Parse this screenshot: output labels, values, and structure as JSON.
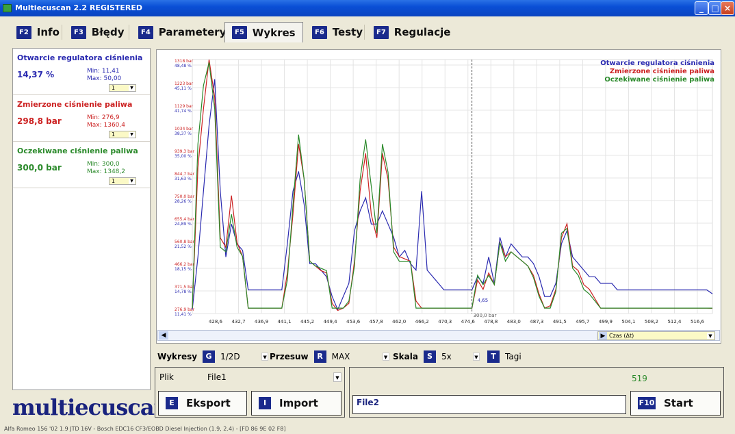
{
  "window": {
    "title": "Multiecuscan 2.2 REGISTERED"
  },
  "tabs": [
    {
      "key": "F2",
      "label": "Info"
    },
    {
      "key": "F3",
      "label": "Błędy"
    },
    {
      "key": "F4",
      "label": "Parametery"
    },
    {
      "key": "F5",
      "label": "Wykres",
      "active": true
    },
    {
      "key": "F6",
      "label": "Testy"
    },
    {
      "key": "F7",
      "label": "Regulacje"
    }
  ],
  "params": [
    {
      "name": "Otwarcie regulatora ciśnienia",
      "value": "14,37 %",
      "min": "Min: 11,41",
      "max": "Max: 50,00",
      "scale": "1",
      "color": "#2a2ab0"
    },
    {
      "name": "Zmierzone ciśnienie paliwa",
      "value": "298,8 bar",
      "min": "Min: 276,9",
      "max": "Max: 1360,4",
      "scale": "1",
      "color": "#cc2222"
    },
    {
      "name": "Oczekiwane ciśnienie paliwa",
      "value": "300,0 bar",
      "min": "Min: 300,0",
      "max": "Max: 1348,2",
      "scale": "1",
      "color": "#2b8a2b"
    }
  ],
  "logo": "multiecuscan",
  "chart_data": {
    "type": "line",
    "x": [
      426,
      427,
      428,
      429,
      430,
      431,
      432,
      433,
      434,
      435,
      436,
      437,
      438,
      439,
      440,
      441,
      442,
      443,
      444,
      445,
      446,
      447,
      448,
      449,
      450,
      451,
      452,
      453,
      454,
      455,
      456,
      457,
      458,
      459,
      460,
      461,
      462,
      463,
      464,
      465,
      466,
      467,
      468,
      469,
      470,
      471,
      472,
      473,
      474,
      475,
      476,
      477,
      478,
      479,
      480,
      481,
      482,
      483,
      484,
      485,
      486,
      487,
      488,
      489,
      490,
      491,
      492,
      493,
      494,
      495,
      496,
      497,
      498,
      499,
      500,
      501,
      502,
      503,
      504,
      505,
      506,
      507,
      508,
      509,
      510,
      511,
      512,
      513,
      514,
      515,
      516,
      517,
      518,
      519
    ],
    "series": [
      {
        "name": "Otwarcie regulatora ciśnienia",
        "color": "#2a2ab0",
        "unit": "%",
        "values": [
          12,
          20,
          30,
          40,
          47,
          30,
          20,
          25,
          22,
          21,
          15,
          15,
          15,
          15,
          15,
          15,
          15,
          22,
          30,
          33,
          28,
          19,
          19,
          18,
          17,
          14,
          12,
          14,
          16,
          24,
          27,
          29,
          25,
          25,
          27,
          25,
          23,
          20,
          21,
          19,
          18,
          30,
          18,
          17,
          16,
          15,
          15,
          15,
          15,
          15,
          15,
          17,
          16,
          20,
          16,
          23,
          20,
          22,
          21,
          20,
          20,
          19,
          17,
          14,
          14,
          16,
          22,
          24,
          20,
          19,
          18,
          17,
          17,
          16,
          16,
          16,
          15,
          15,
          15,
          15,
          15,
          15,
          15,
          15,
          15,
          15,
          15,
          15,
          15,
          15,
          15,
          15,
          15,
          14.4
        ]
      },
      {
        "name": "Zmierzone ciśnienie paliwa",
        "color": "#cc2222",
        "unit": "bar",
        "values": [
          300,
          900,
          1150,
          1360,
          1200,
          600,
          560,
          780,
          580,
          520,
          300,
          300,
          300,
          300,
          300,
          300,
          300,
          450,
          700,
          1000,
          850,
          500,
          480,
          460,
          450,
          320,
          290,
          300,
          320,
          500,
          800,
          960,
          700,
          600,
          960,
          850,
          560,
          520,
          510,
          500,
          330,
          300,
          300,
          300,
          300,
          300,
          300,
          300,
          300,
          300,
          300,
          420,
          380,
          450,
          400,
          580,
          520,
          540,
          520,
          500,
          480,
          440,
          360,
          300,
          310,
          380,
          600,
          660,
          480,
          460,
          400,
          380,
          340,
          300,
          300,
          300,
          300,
          300,
          300,
          300,
          300,
          300,
          300,
          300,
          300,
          300,
          300,
          300,
          300,
          300,
          300,
          300,
          300,
          299
        ]
      },
      {
        "name": "Oczekiwane ciśnienie paliwa",
        "color": "#2b8a2b",
        "unit": "bar",
        "values": [
          300,
          1000,
          1250,
          1348,
          1150,
          560,
          540,
          700,
          560,
          520,
          300,
          300,
          300,
          300,
          300,
          300,
          300,
          420,
          740,
          1040,
          850,
          500,
          480,
          470,
          460,
          300,
          300,
          300,
          330,
          480,
          850,
          1020,
          820,
          620,
          1000,
          880,
          540,
          500,
          500,
          500,
          300,
          300,
          300,
          300,
          300,
          300,
          300,
          300,
          300,
          300,
          300,
          440,
          400,
          440,
          400,
          580,
          500,
          540,
          520,
          500,
          480,
          430,
          350,
          300,
          300,
          370,
          620,
          640,
          470,
          440,
          380,
          360,
          330,
          300,
          300,
          300,
          300,
          300,
          300,
          300,
          300,
          300,
          300,
          300,
          300,
          300,
          300,
          300,
          300,
          300,
          300,
          300,
          300,
          300
        ]
      }
    ],
    "x_ticks": [
      "428,6",
      "432,7",
      "436,9",
      "441,1",
      "445,2",
      "449,4",
      "453,6",
      "457,8",
      "462,0",
      "466,2",
      "470,3",
      "474,6",
      "478,8",
      "483,0",
      "487,3",
      "491,5",
      "495,7",
      "499,9",
      "504,1",
      "508,2",
      "512,4",
      "516,6"
    ],
    "y_ticks": [
      {
        "bar": "1318 bar",
        "pct": "48,48 %"
      },
      {
        "bar": "1223 bar",
        "pct": "45,11 %"
      },
      {
        "bar": "1129 bar",
        "pct": "41,74 %"
      },
      {
        "bar": "1034 bar",
        "pct": "38,37 %"
      },
      {
        "bar": "939,3 bar",
        "pct": "35,00 %"
      },
      {
        "bar": "844,7 bar",
        "pct": "31,63 %"
      },
      {
        "bar": "750,0 bar",
        "pct": "28,26 %"
      },
      {
        "bar": "655,4 bar",
        "pct": "24,89 %"
      },
      {
        "bar": "560,8 bar",
        "pct": "21,52 %"
      },
      {
        "bar": "466,2 bar",
        "pct": "18,15 %"
      },
      {
        "bar": "371,5 bar",
        "pct": "14,78 %"
      },
      {
        "bar": "276,9 bar",
        "pct": "11,41 %"
      }
    ],
    "ylim_bar": [
      276.9,
      1360.4
    ],
    "ylim_pct": [
      11.41,
      50.0
    ],
    "cursor_x": 476,
    "annotations": [
      "4,65",
      "300,0 bar"
    ],
    "legend_position": "top-right",
    "grid": true
  },
  "scrollbar": {
    "czas": "Czas (Δt)"
  },
  "controls": {
    "wykresy_label": "Wykresy",
    "wykresy_key": "G",
    "wykresy_value": "1/2D",
    "przesuw_label": "Przesuw",
    "przesuw_key": "R",
    "przesuw_value": "MAX",
    "skala_label": "Skala",
    "skala_key": "S",
    "skala_value": "5x",
    "tagi_key": "T",
    "tagi_label": "Tagi"
  },
  "plik": {
    "label": "Plik",
    "value": "File1"
  },
  "buttons": {
    "eksport_key": "E",
    "eksport_label": "Eksport",
    "import_key": "I",
    "import_label": "Import",
    "start_key": "F10",
    "start_label": "Start"
  },
  "counter": "519",
  "file2": "File2",
  "status": "Alfa Romeo 156 '02 1.9 JTD 16V - Bosch EDC16 CF3/EOBD Diesel Injection (1.9, 2.4) - [FD 86 9E 02 F8]"
}
